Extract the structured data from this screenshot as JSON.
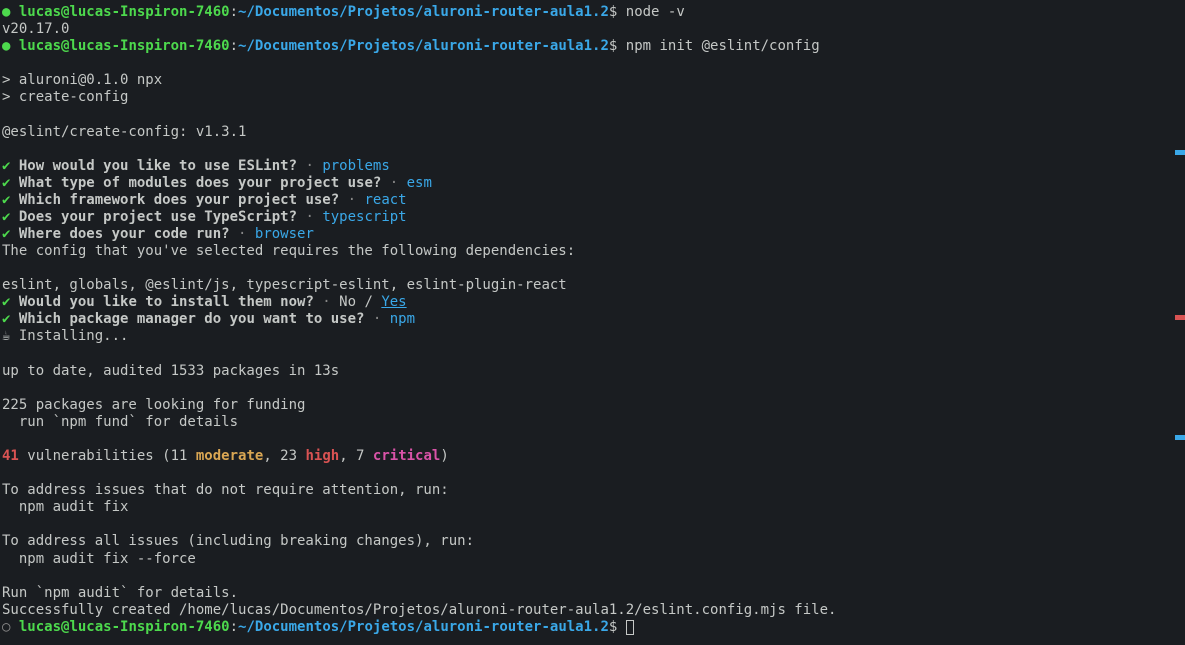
{
  "prompt": {
    "bullet_solid": "●",
    "bullet_hollow": "○",
    "user": "lucas@lucas-Inspiron-7460",
    "colon": ":",
    "path": "~/Documentos/Projetos/aluroni-router-aula1.2",
    "dollar": "$"
  },
  "cmd1": " node -v",
  "out1": "v20.17.0",
  "cmd2": " npm init @eslint/config",
  "npx1": "> aluroni@0.1.0 npx",
  "npx2": "> create-config",
  "version": "@eslint/create-config: v1.3.1",
  "check": "✔",
  "q1": " How would you like to use ESLint?",
  "a1": "problems",
  "q2": " What type of modules does your project use?",
  "a2": "esm",
  "q3": " Which framework does your project use?",
  "a3": "react",
  "q4": " Does your project use TypeScript?",
  "a4": "typescript",
  "q5": " Where does your code run?",
  "a5": "browser",
  "deps1": "The config that you've selected requires the following dependencies:",
  "deps2": "eslint, globals, @eslint/js, typescript-eslint, eslint-plugin-react",
  "q6": " Would you like to install them now?",
  "no": "No",
  "slash": " / ",
  "yes": "Yes",
  "q7": " Which package manager do you want to use?",
  "a7": "npm",
  "spinner": "☕",
  "installing": " Installing...",
  "audit1": "up to date, audited 1533 packages in 13s",
  "fund1": "225 packages are looking for funding",
  "fund2": "  run `npm fund` for details",
  "vuln_count": "41",
  "vuln_mid1": " vulnerabilities (11 ",
  "vuln_moderate": "moderate",
  "vuln_mid2": ", 23 ",
  "vuln_high": "high",
  "vuln_mid3": ", 7 ",
  "vuln_critical": "critical",
  "vuln_end": ")",
  "fix1": "To address issues that do not require attention, run:",
  "fix2": "  npm audit fix",
  "fix3": "To address all issues (including breaking changes), run:",
  "fix4": "  npm audit fix --force",
  "fix5": "Run `npm audit` for details.",
  "success": "Successfully created /home/lucas/Documentos/Projetos/aluroni-router-aula1.2/eslint.config.mjs file.",
  "sep": " · "
}
